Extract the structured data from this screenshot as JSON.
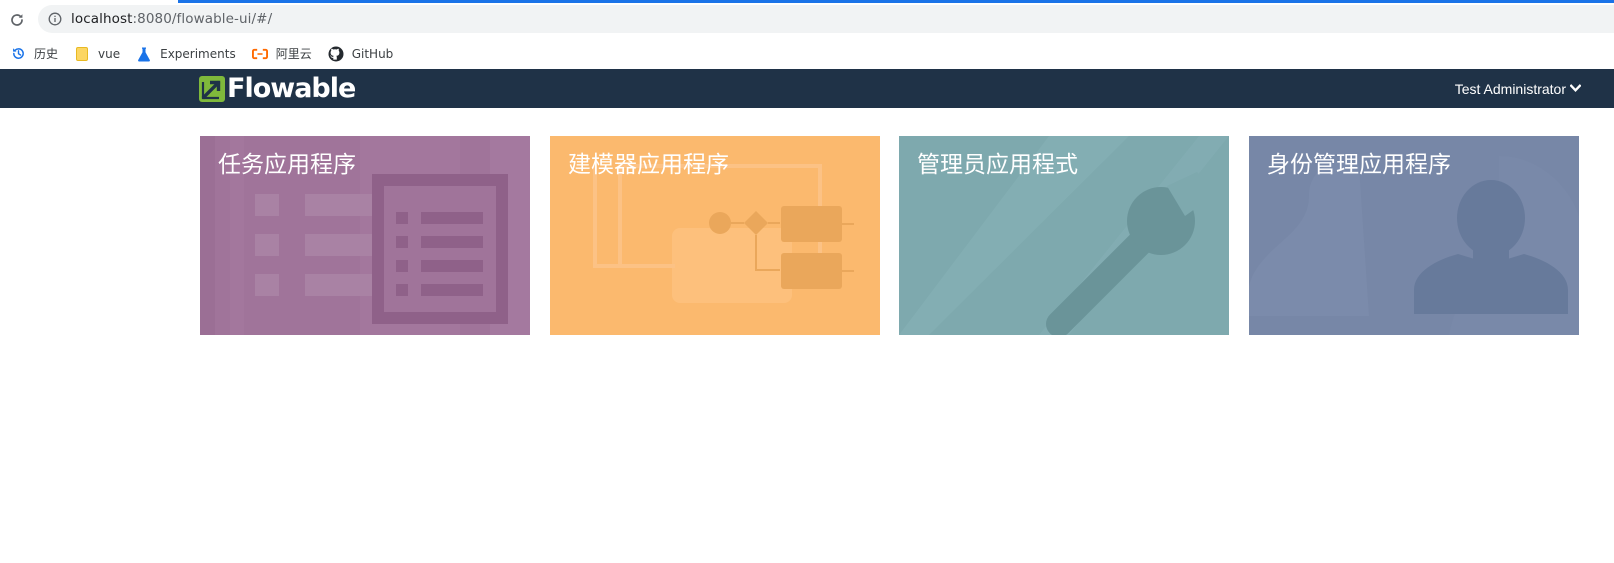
{
  "browser": {
    "url_host": "localhost",
    "url_rest": ":8080/flowable-ui/#/",
    "bookmarks": [
      {
        "label": "历史",
        "icon": "history-icon"
      },
      {
        "label": "vue",
        "icon": "folder-icon"
      },
      {
        "label": "Experiments",
        "icon": "flask-icon"
      },
      {
        "label": "阿里云",
        "icon": "aliyun-icon"
      },
      {
        "label": "GitHub",
        "icon": "github-icon"
      }
    ]
  },
  "navbar": {
    "brand": "Flowable",
    "user_name": "Test Administrator",
    "bg_color": "#1f3247"
  },
  "tiles": [
    {
      "title": "任务应用程序",
      "icon": "task-list-icon",
      "color": "#a0749a"
    },
    {
      "title": "建模器应用程序",
      "icon": "process-diagram-icon",
      "color": "#fbb96e"
    },
    {
      "title": "管理员应用程式",
      "icon": "wrench-icon",
      "color": "#7ea9ae"
    },
    {
      "title": "身份管理应用程序",
      "icon": "user-silhouette-icon",
      "color": "#7787a7"
    }
  ]
}
